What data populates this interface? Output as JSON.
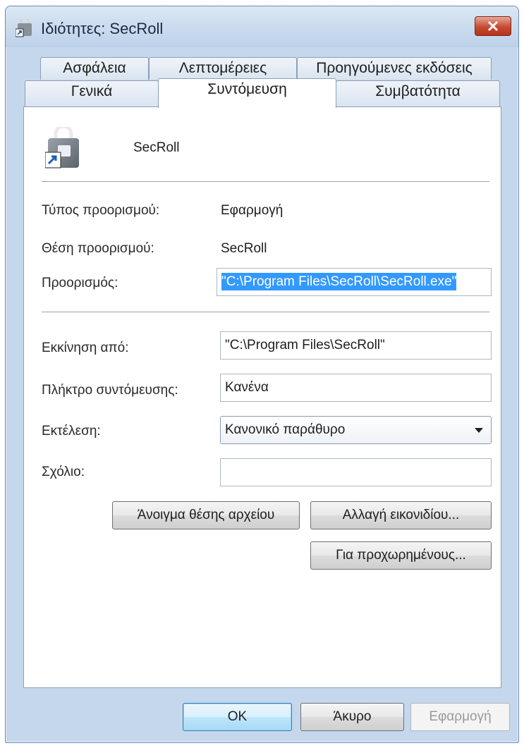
{
  "window": {
    "title": "Ιδιότητες: SecRoll"
  },
  "tabs": {
    "back": [
      "Ασφάλεια",
      "Λεπτομέρειες",
      "Προηγούμενες εκδόσεις"
    ],
    "front": [
      "Γενικά",
      "Συντόμευση",
      "Συμβατότητα"
    ],
    "active": "Συντόμευση"
  },
  "shortcut": {
    "name": "SecRoll",
    "target_type_label": "Τύπος προορισμού:",
    "target_type_value": "Εφαρμογή",
    "target_location_label": "Θέση προορισμού:",
    "target_location_value": "SecRoll",
    "target_label": "Προορισμός:",
    "target_value": "\"C:\\Program Files\\SecRoll\\SecRoll.exe\"",
    "start_in_label": "Εκκίνηση από:",
    "start_in_value": "\"C:\\Program Files\\SecRoll\"",
    "shortcut_key_label": "Πλήκτρο συντόμευσης:",
    "shortcut_key_value": "Κανένα",
    "run_label": "Εκτέλεση:",
    "run_value": "Κανονικό παράθυρο",
    "comment_label": "Σχόλιο:",
    "comment_value": ""
  },
  "buttons": {
    "open_location": "Άνοιγμα θέσης αρχείου",
    "change_icon": "Αλλαγή εικονιδίου...",
    "advanced": "Για προχωρημένους...",
    "ok": "OK",
    "cancel": "Άκυρο",
    "apply": "Εφαρμογή"
  },
  "icons": {
    "title_icon": "shortcut-app-icon",
    "close_icon": "close-icon",
    "app_icon": "lock-app-icon",
    "dropdown_icon": "chevron-down-icon"
  }
}
